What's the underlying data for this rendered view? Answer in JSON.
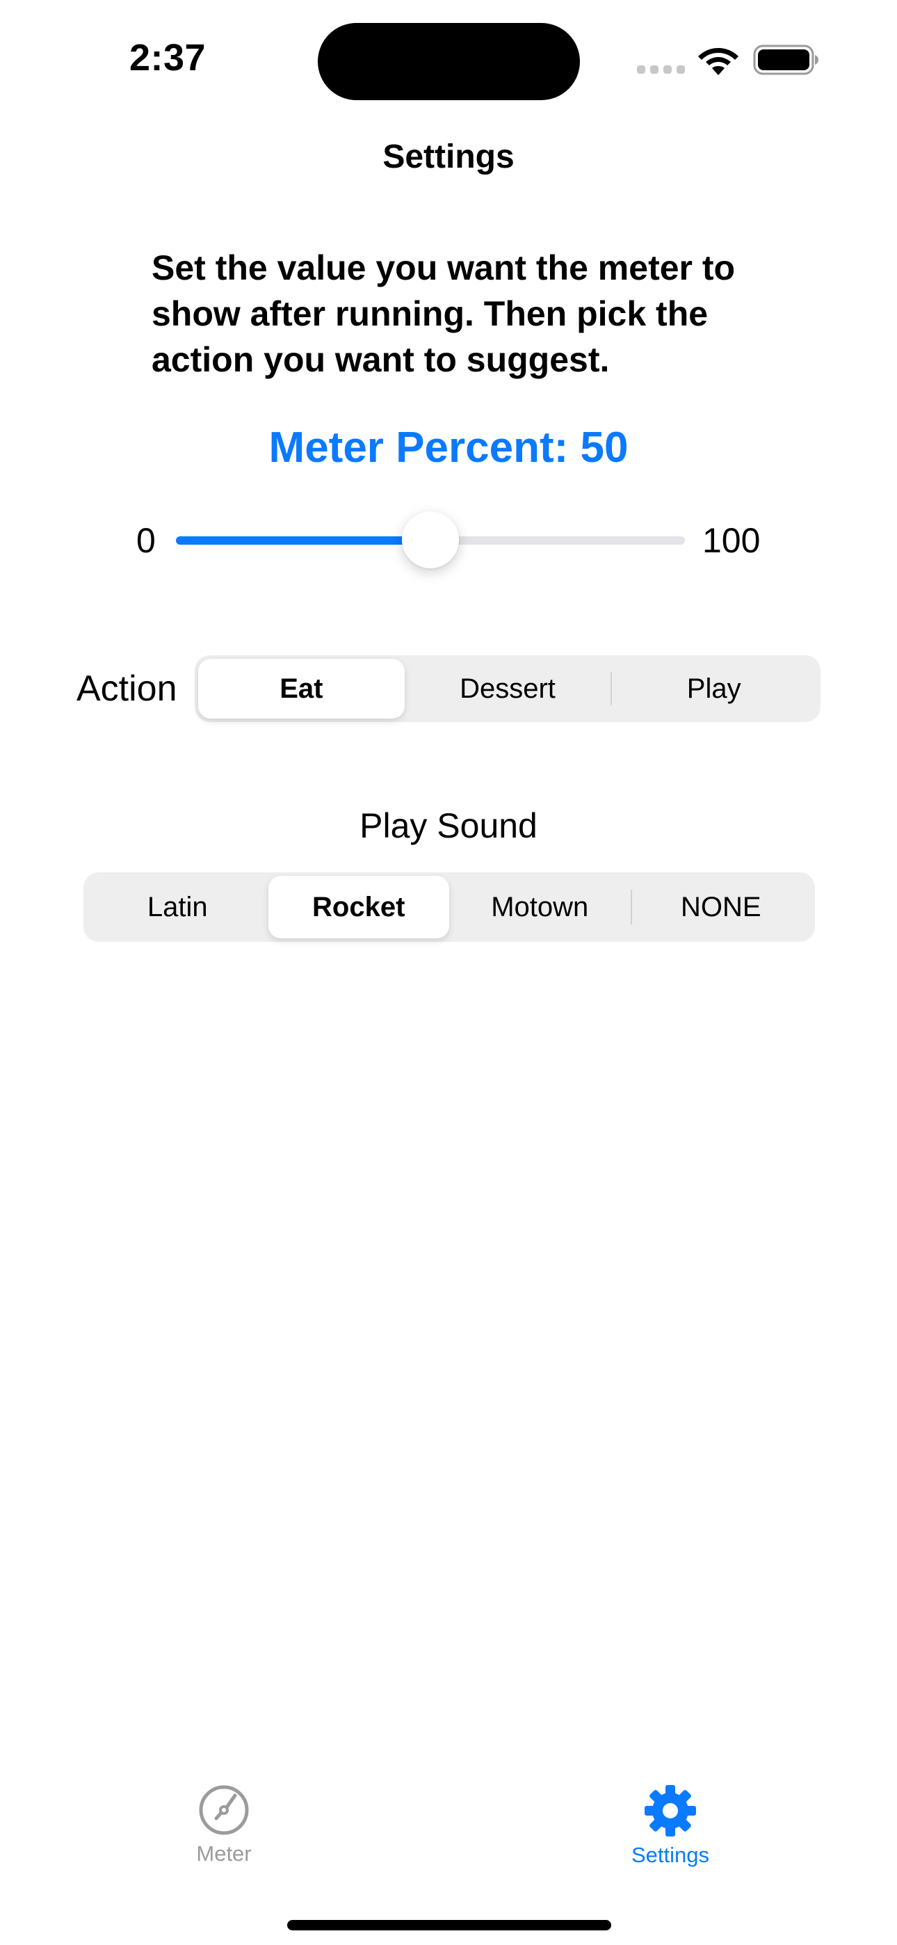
{
  "status_bar": {
    "time": "2:37",
    "icons": [
      "cellular-signal-icon",
      "wifi-icon",
      "battery-icon"
    ]
  },
  "nav": {
    "title": "Settings"
  },
  "instructions": "Set the value you want the meter to show after running. Then pick the action you want to suggest.",
  "meter": {
    "label": "Meter Percent: 50",
    "value": 50,
    "min": 0,
    "max": 100,
    "min_label": "0",
    "max_label": "100"
  },
  "action": {
    "label": "Action",
    "options": [
      "Eat",
      "Dessert",
      "Play"
    ],
    "selected": "Eat"
  },
  "sound": {
    "title": "Play Sound",
    "options": [
      "Latin",
      "Rocket",
      "Motown",
      "NONE"
    ],
    "selected": "Rocket"
  },
  "tab_bar": {
    "items": [
      {
        "label": "Meter",
        "icon": "gauge-icon",
        "active": false
      },
      {
        "label": "Settings",
        "icon": "gear-icon",
        "active": true
      }
    ]
  },
  "colors": {
    "accent": "#0a7aff",
    "inactive": "#9b9b9b",
    "segment_bg": "#eeeeef",
    "track": "#e3e3e8"
  }
}
